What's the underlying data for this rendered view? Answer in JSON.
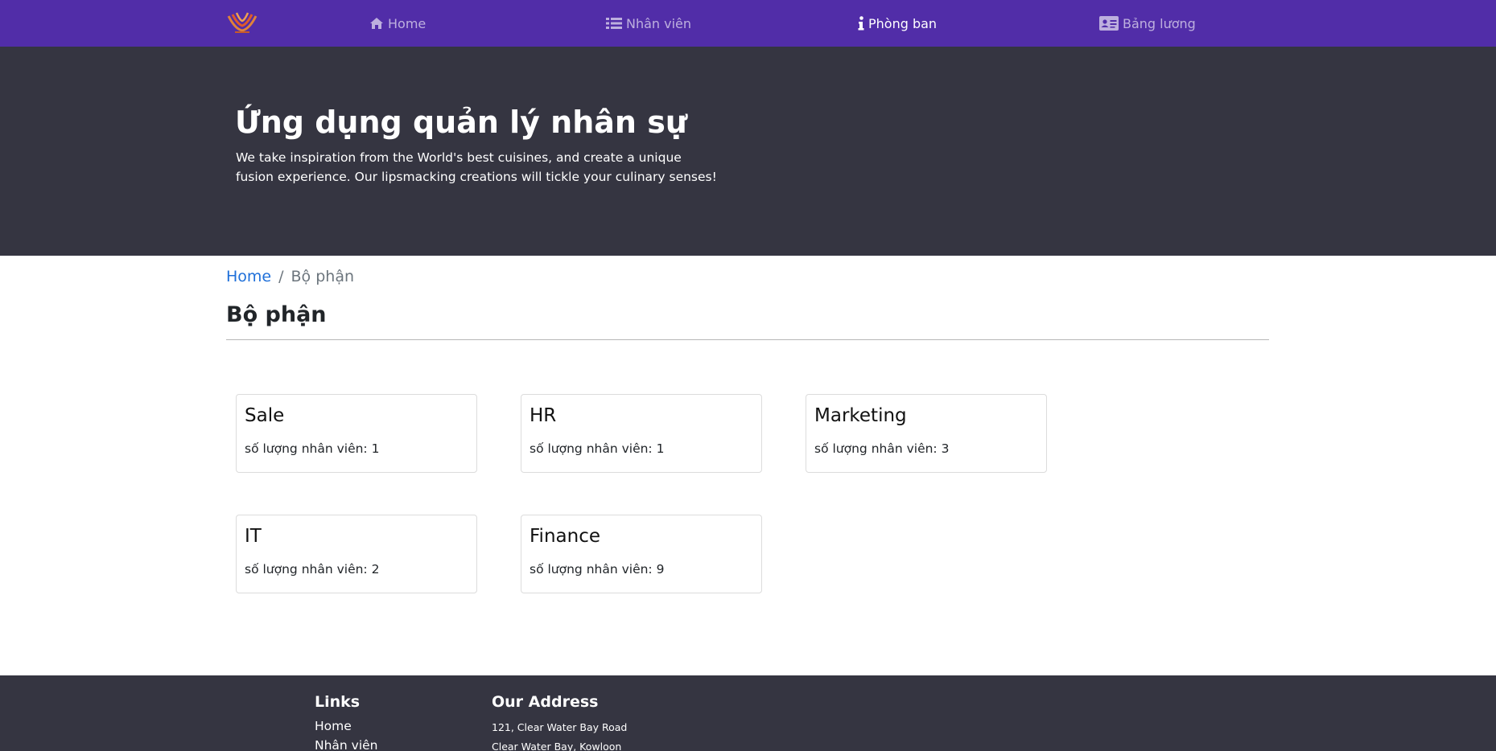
{
  "navbar": {
    "logo_icon": "brand-logo-icon",
    "accent_color": "#512da8",
    "items": [
      {
        "label": "Home",
        "icon": "home-icon",
        "active": false
      },
      {
        "label": "Nhân viên",
        "icon": "list-icon",
        "active": false
      },
      {
        "label": "Phòng ban",
        "icon": "info-icon",
        "active": true
      },
      {
        "label": "Bảng lương",
        "icon": "id-card-icon",
        "active": false
      }
    ]
  },
  "jumbotron": {
    "title": "Ứng dụng quản lý nhân sự",
    "description": "We take inspiration from the World's best cuisines, and create a unique fusion experience. Our lipsmacking creations will tickle your culinary senses!"
  },
  "breadcrumb": {
    "home": "Home",
    "separator": "/",
    "current": "Bộ phận"
  },
  "page": {
    "title": "Bộ phận"
  },
  "departments": [
    {
      "name": "Sale",
      "count_text": "số lượng nhân viên: 1"
    },
    {
      "name": "HR",
      "count_text": "số lượng nhân viên: 1"
    },
    {
      "name": "Marketing",
      "count_text": "số lượng nhân viên: 3"
    },
    {
      "name": "IT",
      "count_text": "số lượng nhân viên: 2"
    },
    {
      "name": "Finance",
      "count_text": "số lượng nhân viên: 9"
    }
  ],
  "footer": {
    "links_title": "Links",
    "links": [
      "Home",
      "Nhân viên"
    ],
    "address_title": "Our Address",
    "address_lines": [
      "121, Clear Water Bay Road",
      "Clear Water Bay, Kowloon"
    ]
  }
}
